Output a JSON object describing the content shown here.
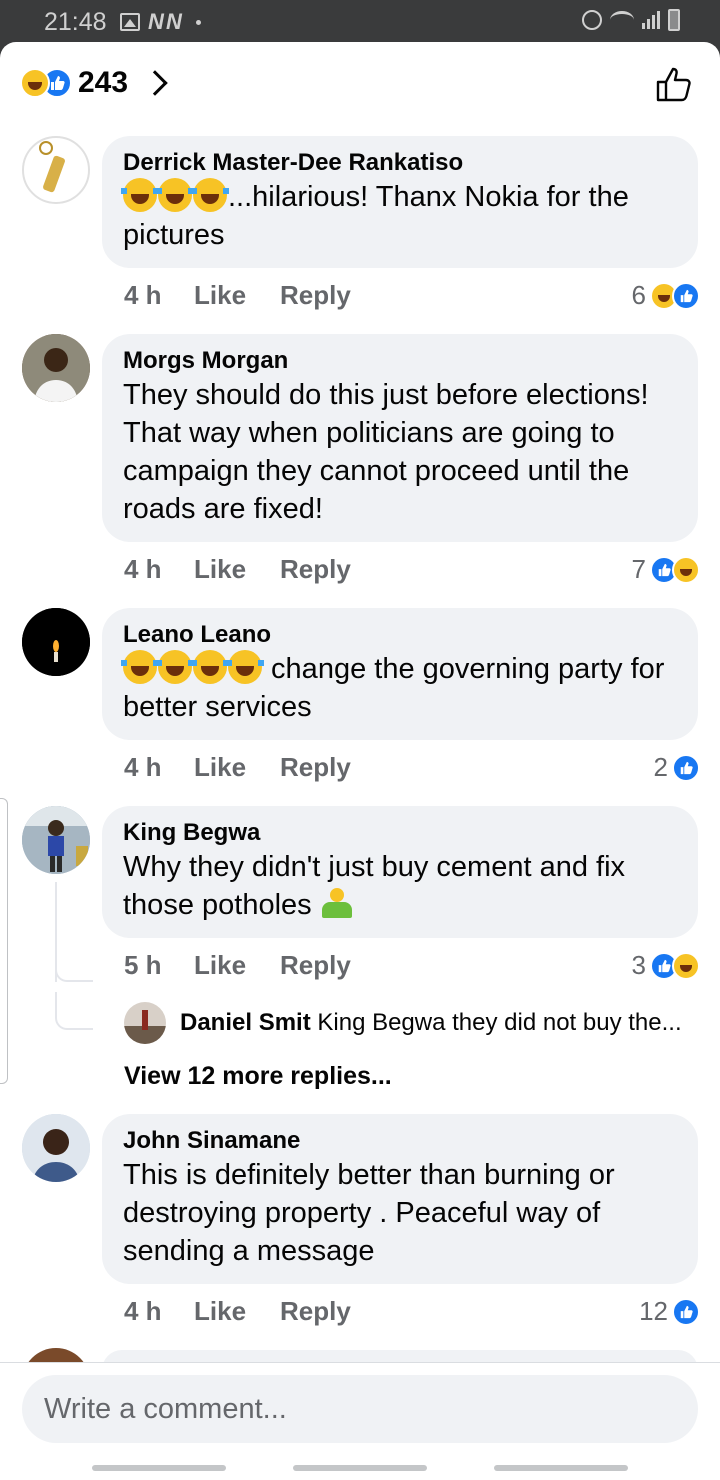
{
  "status_bar": {
    "time": "21:48",
    "carrier_icons": "N N"
  },
  "header": {
    "reaction_count": "243"
  },
  "comments": [
    {
      "author": "Derrick Master-Dee Rankatiso",
      "text": "...hilarious! Thanx Nokia for the pictures",
      "time": "4 h",
      "like": "Like",
      "reply": "Reply",
      "reaction_count": "6"
    },
    {
      "author": "Morgs Morgan",
      "text": "They should do this just before elections! That way when politicians are going to campaign they cannot proceed until the roads are fixed!",
      "time": "4 h",
      "like": "Like",
      "reply": "Reply",
      "reaction_count": "7"
    },
    {
      "author": "Leano Leano",
      "text": " change the governing party for better services",
      "time": "4 h",
      "like": "Like",
      "reply": "Reply",
      "reaction_count": "2"
    },
    {
      "author": "King Begwa",
      "text": "Why they didn't just buy cement and fix those potholes ",
      "time": "5 h",
      "like": "Like",
      "reply": "Reply",
      "reaction_count": "3"
    },
    {
      "author": "John Sinamane",
      "text": "This is definitely better than burning or destroying property . Peaceful way of sending a message",
      "time": "4 h",
      "like": "Like",
      "reply": "Reply",
      "reaction_count": "12"
    }
  ],
  "reply_preview": {
    "author": "Daniel Smit",
    "text": "King Begwa they did not buy the..."
  },
  "view_more": "View 12 more replies...",
  "composer": {
    "placeholder": "Write a comment..."
  },
  "colors": {
    "like_blue": "#1877f2",
    "bubble": "#f0f2f5",
    "secondary_text": "#65676b",
    "haha_yellow": "#f7c325"
  }
}
